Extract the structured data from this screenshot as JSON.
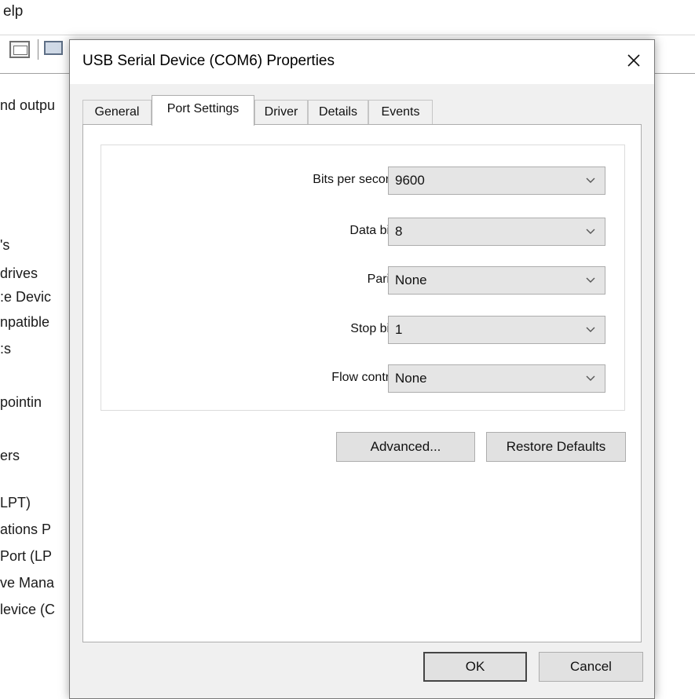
{
  "background_window": {
    "menu": {
      "help_label": "elp"
    },
    "tree_items": [
      "nd outpu",
      "'s",
      "drives",
      ":e Devic",
      "npatible",
      ":s",
      "pointin",
      "ers",
      "LPT)",
      "ations P",
      "Port (LP",
      "ve Mana",
      "levice (C"
    ]
  },
  "dialog": {
    "title": "USB Serial Device (COM6) Properties",
    "close_label": "×",
    "tabs": [
      {
        "label": "General",
        "active": false
      },
      {
        "label": "Port Settings",
        "active": true
      },
      {
        "label": "Driver",
        "active": false
      },
      {
        "label": "Details",
        "active": false
      },
      {
        "label": "Events",
        "active": false
      }
    ],
    "port_settings": {
      "fields": [
        {
          "label": "Bits per second:",
          "value": "9600"
        },
        {
          "label": "Data bits:",
          "value": "8"
        },
        {
          "label": "Parity:",
          "value": "None"
        },
        {
          "label": "Stop bits:",
          "value": "1"
        },
        {
          "label": "Flow control:",
          "value": "None"
        }
      ],
      "advanced_label": "Advanced...",
      "restore_defaults_label": "Restore Defaults"
    },
    "buttons": {
      "ok_label": "OK",
      "cancel_label": "Cancel"
    }
  },
  "icons": {
    "close": "close-icon",
    "dropdown": "chevron-down-icon",
    "toolbar_properties": "properties-icon",
    "toolbar_monitor": "monitor-icon"
  },
  "colors": {
    "dialog_background": "#f0f0f0",
    "panel_background": "#ffffff",
    "combo_background": "#e5e5e5",
    "button_background": "#e1e1e1",
    "border": "#adadad"
  }
}
